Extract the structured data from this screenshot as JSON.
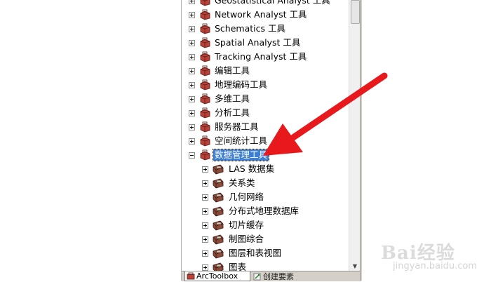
{
  "tree": {
    "items": [
      {
        "label": "Geostatistical Analyst 工具",
        "state": "plus",
        "level": 0
      },
      {
        "label": "Network Analyst 工具",
        "state": "plus",
        "level": 0
      },
      {
        "label": "Schematics 工具",
        "state": "plus",
        "level": 0
      },
      {
        "label": "Spatial Analyst 工具",
        "state": "plus",
        "level": 0
      },
      {
        "label": "Tracking Analyst 工具",
        "state": "plus",
        "level": 0
      },
      {
        "label": "编辑工具",
        "state": "plus",
        "level": 0
      },
      {
        "label": "地理编码工具",
        "state": "plus",
        "level": 0
      },
      {
        "label": "多维工具",
        "state": "plus",
        "level": 0
      },
      {
        "label": "分析工具",
        "state": "plus",
        "level": 0
      },
      {
        "label": "服务器工具",
        "state": "plus",
        "level": 0
      },
      {
        "label": "空间统计工具",
        "state": "plus",
        "level": 0
      },
      {
        "label": "数据管理工具",
        "state": "minus",
        "level": 0,
        "selected": true
      },
      {
        "label": "LAS 数据集",
        "state": "plus",
        "level": 1
      },
      {
        "label": "关系类",
        "state": "plus",
        "level": 1
      },
      {
        "label": "几何网络",
        "state": "plus",
        "level": 1
      },
      {
        "label": "分布式地理数据库",
        "state": "plus",
        "level": 1
      },
      {
        "label": "切片缓存",
        "state": "plus",
        "level": 1
      },
      {
        "label": "制图综合",
        "state": "plus",
        "level": 1
      },
      {
        "label": "图层和表视图",
        "state": "plus",
        "level": 1
      },
      {
        "label": "图表",
        "state": "plus",
        "level": 1
      }
    ]
  },
  "tabs": [
    {
      "label": "ArcToolbox",
      "icon": "toolbox-icon",
      "active": true
    },
    {
      "label": "创建要素",
      "icon": "create-features-icon",
      "active": false
    }
  ],
  "watermark": {
    "text": "Bai经验",
    "url": "jingyan.baidu.com"
  },
  "colors": {
    "selection": "#3d7fd6",
    "arrow": "#e8191c",
    "toolbox": "#b8423a"
  }
}
